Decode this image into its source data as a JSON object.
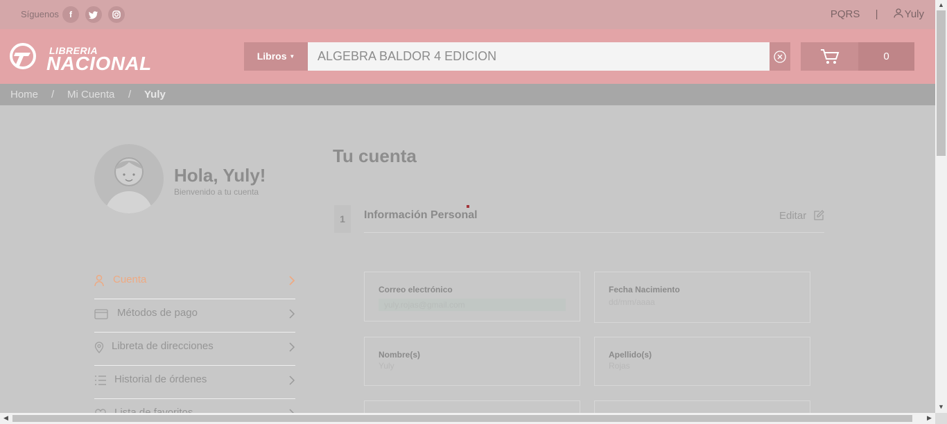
{
  "topbar": {
    "follow_label": "Síguenos",
    "pqrs_label": "PQRS",
    "separator": "|",
    "user_label": "Yuly"
  },
  "header": {
    "logo_top": "LIBRERIA",
    "logo_bottom": "NACIONAL",
    "category_label": "Libros",
    "search_value": "ALGEBRA BALDOR 4 EDICION",
    "cart_count": "0"
  },
  "breadcrumb": {
    "items": [
      "Home",
      "Mi Cuenta",
      "Yuly"
    ],
    "separator": "/"
  },
  "profile": {
    "greeting": "Hola, Yuly!",
    "welcome": "Bienvenido a tu cuenta"
  },
  "menu": {
    "items": [
      {
        "label": "Cuenta"
      },
      {
        "label": "Métodos de pago"
      },
      {
        "label": "Libreta de direcciones"
      },
      {
        "label": "Historial de órdenes"
      },
      {
        "label": "Lista de favoritos"
      }
    ]
  },
  "account": {
    "title": "Tu cuenta",
    "step": "1",
    "section_title": "Información Personal",
    "edit_label": "Editar",
    "fields": {
      "email_label": "Correo electrónico",
      "email_value": "yuly.rojas@gmail.com",
      "birth_label": "Fecha Nacimiento",
      "birth_placeholder": "dd/mm/aaaa",
      "name_label": "Nombre(s)",
      "name_value": "Yuly",
      "lastname_label": "Apellido(s)",
      "lastname_value": "Rojas"
    }
  },
  "colors": {
    "topbar": "#d4a7a9",
    "header": "#e3a4a7",
    "active_menu": "#eeaa83",
    "overlay_bg": "#c8c8c8"
  }
}
